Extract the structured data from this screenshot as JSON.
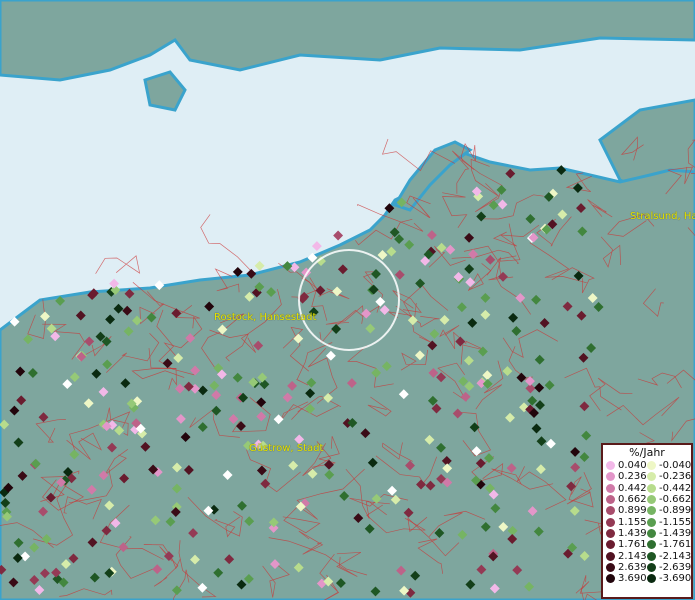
{
  "places": [
    {
      "id": "rostock",
      "label": "Rostock, Hansestadt"
    },
    {
      "id": "stralsund",
      "label": "Stralsund, Ha"
    },
    {
      "id": "guestrow",
      "label": "Güstrow, Stadt"
    }
  ],
  "legend": {
    "title": "%/Jahr",
    "positive": [
      {
        "value": "0.040",
        "color": "#f2b8e8"
      },
      {
        "value": "0.236",
        "color": "#e396c9"
      },
      {
        "value": "0.442",
        "color": "#d07aa8"
      },
      {
        "value": "0.662",
        "color": "#bd6389"
      },
      {
        "value": "0.899",
        "color": "#a84d6c"
      },
      {
        "value": "1.155",
        "color": "#943a55"
      },
      {
        "value": "1.439",
        "color": "#7f2a40"
      },
      {
        "value": "1.761",
        "color": "#6a1c2f"
      },
      {
        "value": "2.143",
        "color": "#521322"
      },
      {
        "value": "2.639",
        "color": "#3a0b16"
      },
      {
        "value": "3.690",
        "color": "#22050c"
      }
    ],
    "negative": [
      {
        "value": "-0.040",
        "color": "#eef7c6"
      },
      {
        "value": "-0.236",
        "color": "#d6ecaa"
      },
      {
        "value": "-0.442",
        "color": "#b7dc8c"
      },
      {
        "value": "-0.662",
        "color": "#96c977"
      },
      {
        "value": "-0.899",
        "color": "#76b463"
      },
      {
        "value": "-1.155",
        "color": "#5a9e50"
      },
      {
        "value": "-1.439",
        "color": "#43873f"
      },
      {
        "value": "-1.761",
        "color": "#2f6f30"
      },
      {
        "value": "-2.143",
        "color": "#1f5724"
      },
      {
        "value": "-2.639",
        "color": "#133f19"
      },
      {
        "value": "-3.690",
        "color": "#0a2a10"
      }
    ]
  },
  "colors": {
    "sea": "#dfeef5",
    "land": "#7ea69e",
    "coast": "#3aa3cc",
    "borders": "#cc3333",
    "highlight": "#ffffff"
  }
}
